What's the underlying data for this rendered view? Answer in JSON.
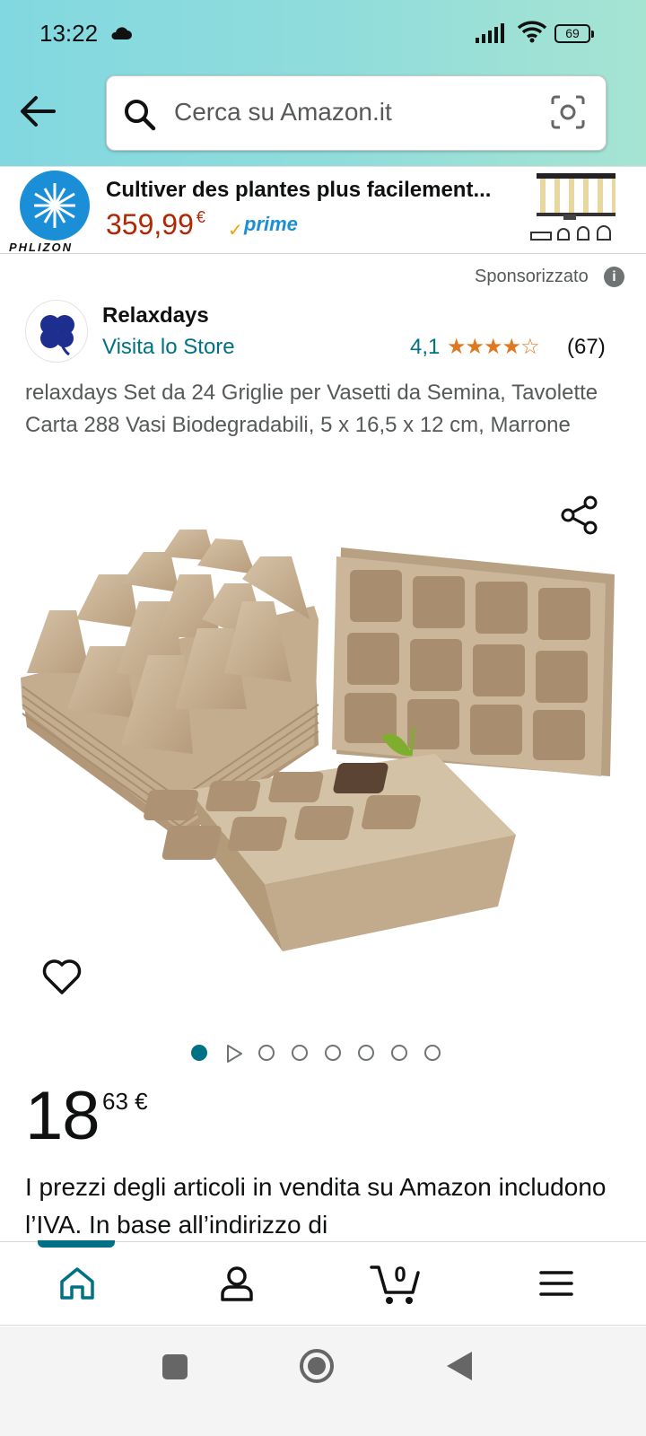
{
  "status_bar": {
    "time": "13:22",
    "battery": "69"
  },
  "header": {
    "search_placeholder": "Cerca su Amazon.it"
  },
  "ad": {
    "brand": "PHLIZON",
    "title": "Cultiver des plantes plus facilement...",
    "price": "359,99",
    "currency": "€",
    "prime_label": "prime"
  },
  "sponsored_label": "Sponsorizzato",
  "store": {
    "name": "Relaxdays",
    "link": "Visita lo Store",
    "rating": "4,1",
    "stars": "★★★★☆",
    "rating_count": "(67)"
  },
  "product": {
    "title": "relaxdays Set da 24 Griglie per Vasetti da Semina, Tavolette Carta 288 Vasi Biodegradabili, 5 x 16,5 x 12 cm, Marrone",
    "price_whole": "18",
    "price_fraction": "63 €",
    "vat_text": "I prezzi degli articoli in vendita su Amazon includono l’IVA. In base all’indirizzo di"
  },
  "gallery": {
    "total_dots": 8,
    "active_index": 0
  },
  "bottom_nav": {
    "items": [
      {
        "name": "home-icon",
        "active": true
      },
      {
        "name": "account-icon",
        "active": false
      },
      {
        "name": "cart-icon",
        "active": false,
        "count": "0"
      },
      {
        "name": "menu-icon",
        "active": false
      }
    ]
  },
  "colors": {
    "accent": "#007185",
    "price_red": "#b12704",
    "star": "#de7921",
    "prime_blue": "#1b8fd3"
  }
}
